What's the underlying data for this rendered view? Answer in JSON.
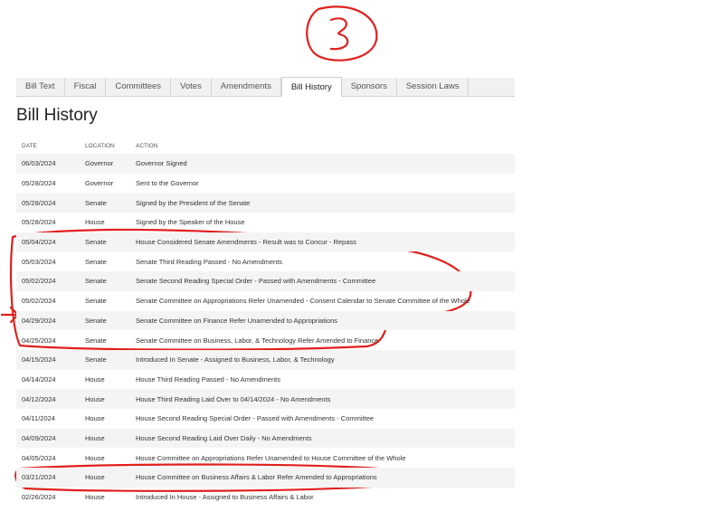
{
  "annotation": {
    "page_number": "3"
  },
  "tabs": [
    {
      "label": "Bill Text",
      "active": false
    },
    {
      "label": "Fiscal",
      "active": false
    },
    {
      "label": "Committees",
      "active": false
    },
    {
      "label": "Votes",
      "active": false
    },
    {
      "label": "Amendments",
      "active": false
    },
    {
      "label": "Bill History",
      "active": true
    },
    {
      "label": "Sponsors",
      "active": false
    },
    {
      "label": "Session Laws",
      "active": false
    }
  ],
  "page_title": "Bill History",
  "table": {
    "headers": {
      "date": "Date",
      "location": "Location",
      "action": "Action"
    },
    "rows": [
      {
        "date": "06/03/2024",
        "location": "Governor",
        "action": "Governor Signed"
      },
      {
        "date": "05/28/2024",
        "location": "Governor",
        "action": "Sent to the Governor"
      },
      {
        "date": "05/28/2024",
        "location": "Senate",
        "action": "Signed by the President of the Senate"
      },
      {
        "date": "05/28/2024",
        "location": "House",
        "action": "Signed by the Speaker of the House"
      },
      {
        "date": "05/04/2024",
        "location": "Senate",
        "action": "House Considered Senate Amendments - Result was to Concur - Repass"
      },
      {
        "date": "05/03/2024",
        "location": "Senate",
        "action": "Senate Third Reading Passed - No Amendments"
      },
      {
        "date": "05/02/2024",
        "location": "Senate",
        "action": "Senate Second Reading Special Order - Passed with Amendments - Committee"
      },
      {
        "date": "05/02/2024",
        "location": "Senate",
        "action": "Senate Committee on Appropriations Refer Unamended - Consent Calendar to Senate Committee of the Whole"
      },
      {
        "date": "04/29/2024",
        "location": "Senate",
        "action": "Senate Committee on Finance Refer Unamended to Appropriations"
      },
      {
        "date": "04/25/2024",
        "location": "Senate",
        "action": "Senate Committee on Business, Labor, & Technology Refer Amended to Finance"
      },
      {
        "date": "04/15/2024",
        "location": "Senate",
        "action": "Introduced In Senate - Assigned to Business, Labor, & Technology"
      },
      {
        "date": "04/14/2024",
        "location": "House",
        "action": "House Third Reading Passed - No Amendments"
      },
      {
        "date": "04/12/2024",
        "location": "House",
        "action": "House Third Reading Laid Over to 04/14/2024 - No Amendments"
      },
      {
        "date": "04/11/2024",
        "location": "House",
        "action": "House Second Reading Special Order - Passed with Amendments - Committee"
      },
      {
        "date": "04/09/2024",
        "location": "House",
        "action": "House Second Reading Laid Over Daily - No Amendments"
      },
      {
        "date": "04/05/2024",
        "location": "House",
        "action": "House Committee on Appropriations Refer Unamended to House Committee of the Whole"
      },
      {
        "date": "03/21/2024",
        "location": "House",
        "action": "House Committee on Business Affairs & Labor Refer Amended to Appropriations"
      },
      {
        "date": "02/26/2024",
        "location": "House",
        "action": "Introduced In House - Assigned to Business Affairs & Labor"
      }
    ]
  },
  "colors": {
    "ink": "#e0201c",
    "row_stripe": "#f4f4f4",
    "tab_bar": "#f1f1f1"
  }
}
